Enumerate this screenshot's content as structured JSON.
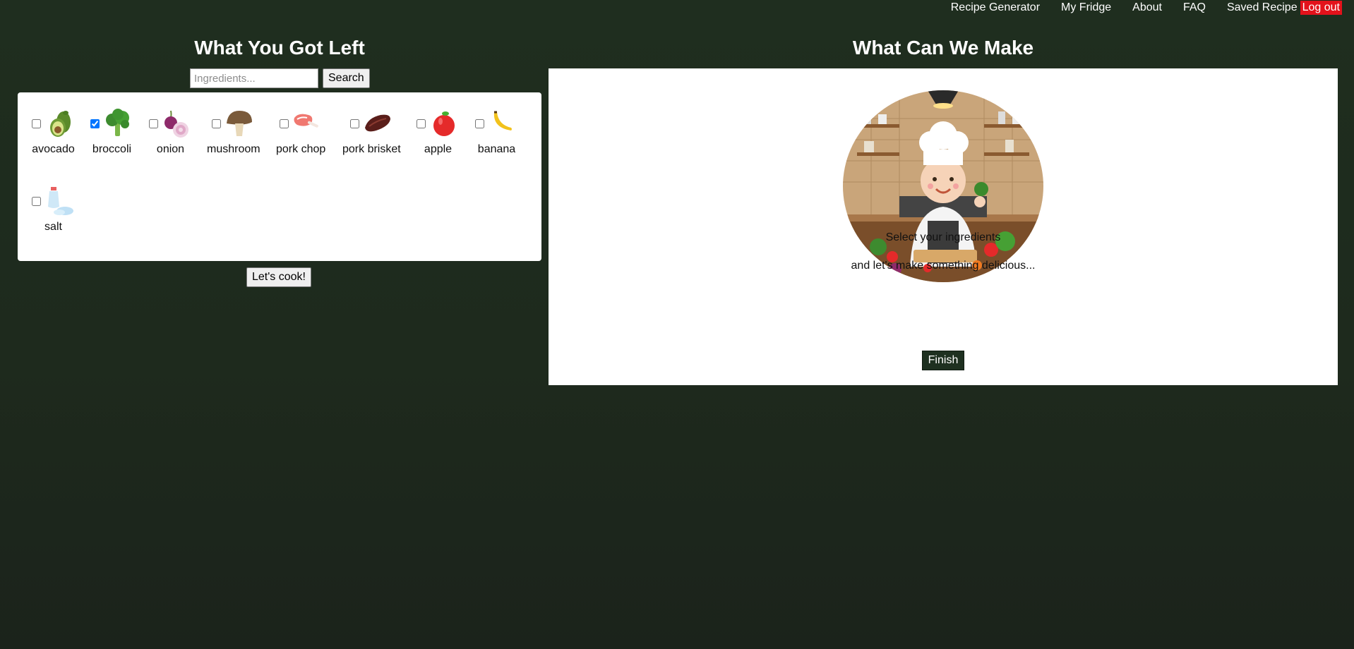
{
  "nav": {
    "items": [
      "Recipe Generator",
      "My Fridge",
      "About",
      "FAQ",
      "Saved Recipe"
    ],
    "logout": "Log out",
    "logout_color": "#e3121b"
  },
  "left": {
    "title": "What You Got Left",
    "search_placeholder": "Ingredients...",
    "search_button": "Search",
    "ingredients": [
      {
        "name": "avocado",
        "checked": false,
        "icon": "avocado-icon"
      },
      {
        "name": "broccoli",
        "checked": true,
        "icon": "broccoli-icon"
      },
      {
        "name": "onion",
        "checked": false,
        "icon": "onion-icon"
      },
      {
        "name": "mushroom",
        "checked": false,
        "icon": "mushroom-icon"
      },
      {
        "name": "pork chop",
        "checked": false,
        "icon": "pork-chop-icon"
      },
      {
        "name": "pork brisket",
        "checked": false,
        "icon": "pork-brisket-icon"
      },
      {
        "name": "apple",
        "checked": false,
        "icon": "apple-icon"
      },
      {
        "name": "banana",
        "checked": false,
        "icon": "banana-icon"
      },
      {
        "name": "salt",
        "checked": false,
        "icon": "salt-icon"
      }
    ],
    "cook_button": "Let's cook!"
  },
  "right": {
    "title": "What Can We Make",
    "image": "chef-illustration",
    "line1": "Select your ingredients",
    "line2": "and let's make something delicious...",
    "finish_button": "Finish"
  },
  "colors": {
    "background": "#1f2d1f",
    "finish_button": "#1e3020"
  }
}
